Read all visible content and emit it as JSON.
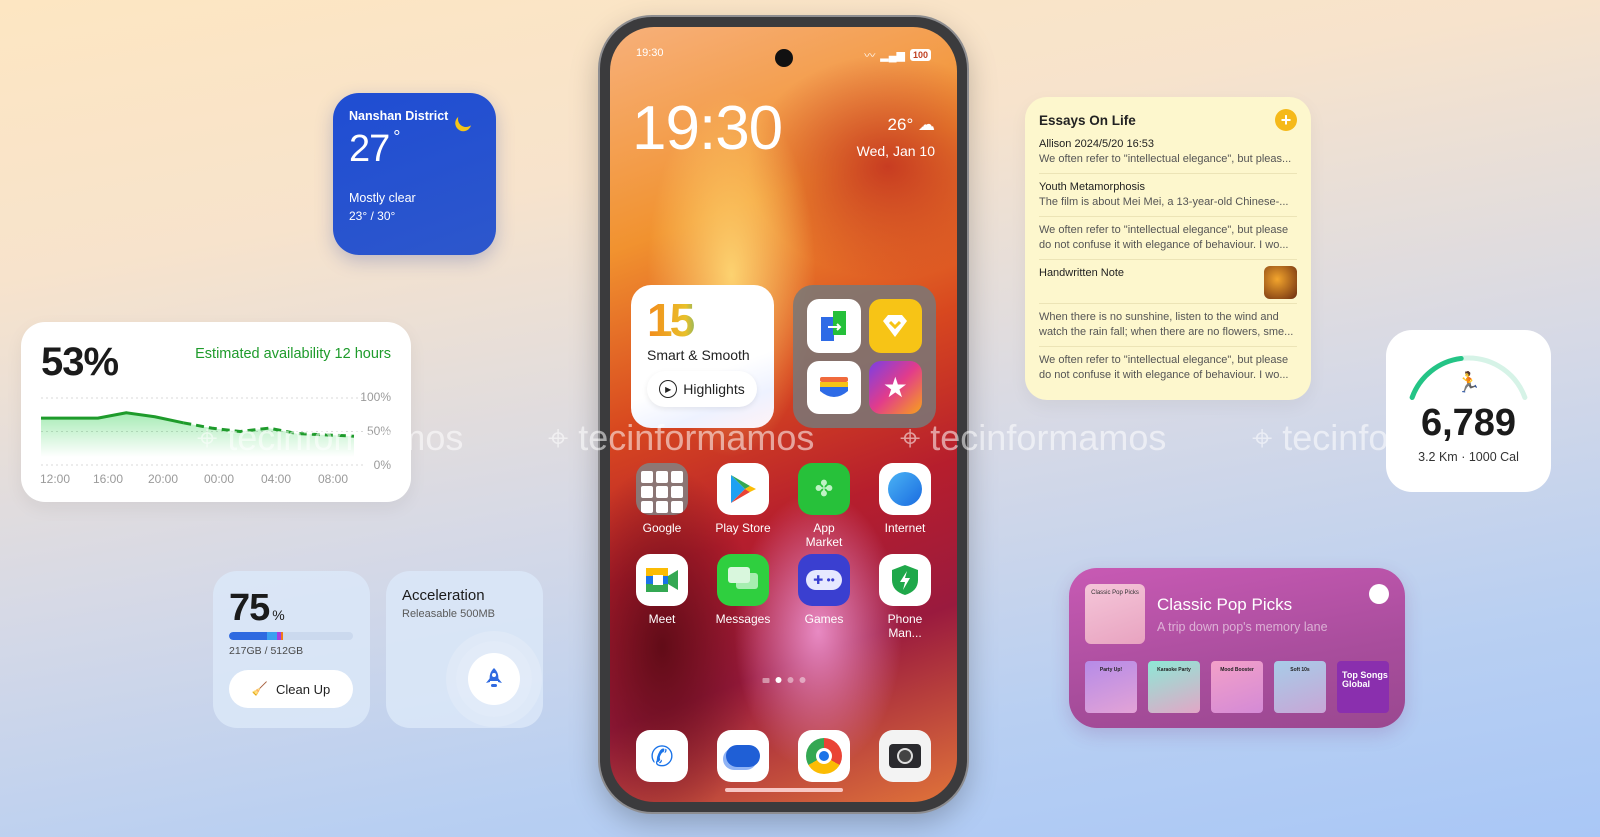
{
  "weather_widget": {
    "location": "Nanshan District",
    "temperature": "27",
    "degree_symbol": "°",
    "condition": "Mostly clear",
    "range": "23° / 30°",
    "icon": "moon-icon"
  },
  "battery_widget": {
    "percent": "53%",
    "estimate": "Estimated availability 12 hours",
    "y_ticks": [
      "100%",
      "50%",
      "0%"
    ],
    "x_ticks": [
      "12:00",
      "16:00",
      "20:00",
      "00:00",
      "04:00",
      "08:00"
    ],
    "series_actual": [
      [
        0,
        70
      ],
      [
        1,
        70
      ],
      [
        2,
        70
      ],
      [
        3,
        78
      ],
      [
        4,
        72
      ],
      [
        5,
        63
      ]
    ],
    "series_forecast": [
      [
        5,
        63
      ],
      [
        6,
        55
      ],
      [
        7,
        50
      ],
      [
        8,
        55
      ],
      [
        9,
        47
      ],
      [
        10,
        45
      ],
      [
        11,
        43
      ]
    ],
    "accent_color": "#1e9b2b"
  },
  "storage_widget": {
    "percent": "75",
    "percent_unit": "%",
    "usage": "217GB / 512GB",
    "used_fraction": 0.42,
    "button_label": "Clean Up"
  },
  "acceleration_widget": {
    "title": "Acceleration",
    "subtitle": "Releasable 500MB"
  },
  "phone": {
    "status_time": "19:30",
    "battery_level": "100",
    "clock": "19:30",
    "weather_temp": "26°",
    "date": "Wed, Jan 10",
    "promo_number": "15",
    "promo_tagline": "Smart & Smooth",
    "promo_button": "Highlights",
    "apps_row1": [
      {
        "label": "Google",
        "icon": "google-folder-icon"
      },
      {
        "label": "Play Store",
        "icon": "play-store-icon"
      },
      {
        "label": "App Market",
        "icon": "app-market-icon"
      },
      {
        "label": "Internet",
        "icon": "internet-icon"
      }
    ],
    "apps_row2": [
      {
        "label": "Meet",
        "icon": "meet-icon"
      },
      {
        "label": "Messages",
        "icon": "messages-icon"
      },
      {
        "label": "Games",
        "icon": "games-icon"
      },
      {
        "label": "Phone Man...",
        "icon": "phone-manager-icon"
      }
    ],
    "dock": [
      {
        "icon": "phone-icon"
      },
      {
        "icon": "google-messages-icon"
      },
      {
        "icon": "chrome-icon"
      },
      {
        "icon": "camera-icon"
      }
    ],
    "page_count": 3,
    "active_page": 1
  },
  "watermark": "tecinformamos",
  "notes_widget": {
    "title": "Essays On Life",
    "notes": [
      {
        "title": "Allison 2024/5/20 16:53",
        "body": "We often refer to \"intellectual elegance\", but pleas..."
      },
      {
        "title": "Youth Metamorphosis",
        "body": "The film is about Mei Mei, a 13-year-old Chinese-..."
      },
      {
        "title": "",
        "body": "We often refer to \"intellectual elegance\", but please do not confuse it with elegance of behaviour. I wo..."
      },
      {
        "title": "Handwritten Note",
        "body": ""
      },
      {
        "title": "",
        "body": "When there is no sunshine, listen to the wind and watch the rain fall; when there are no flowers, sme..."
      },
      {
        "title": "",
        "body": "We often refer to \"intellectual elegance\", but please do not confuse it with elegance of behaviour. I wo..."
      }
    ]
  },
  "steps_widget": {
    "steps": "6,789",
    "details": "3.2 Km · 1000 Cal",
    "goal_fraction": 0.45
  },
  "music_widget": {
    "cover_label": "Classic Pop Picks",
    "title": "Classic Pop Picks",
    "description": "A trip down pop's memory lane",
    "playlists": [
      "Party Up!",
      "Karaoke Party",
      "Mood Booster",
      "Soft 10s",
      "Top Songs Global"
    ]
  }
}
